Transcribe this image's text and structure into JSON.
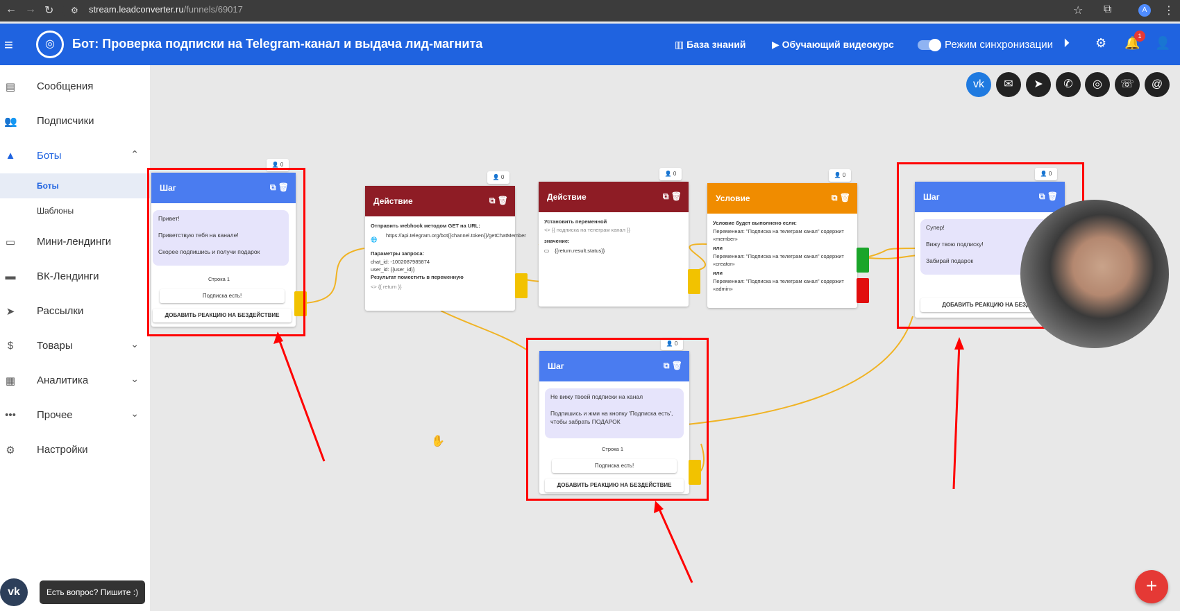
{
  "browser": {
    "url_host": "stream.leadconverter.ru",
    "url_path": "/funnels/69017",
    "profile_letter": "A"
  },
  "header": {
    "title": "Бот: Проверка подписки на Telegram-канал и выдача лид-магнита",
    "knowledge_base": "База знаний",
    "video_course": "Обучающий видеокурс",
    "sync_mode": "Режим синхронизации",
    "notifications_count": "1",
    "accent_color": "#1f63e0"
  },
  "sidebar": {
    "items": [
      {
        "label": "Сообщения",
        "icon": "message-icon"
      },
      {
        "label": "Подписчики",
        "icon": "people-icon"
      },
      {
        "label": "Боты",
        "icon": "robot-icon"
      },
      {
        "label": "Мини-лендинги",
        "icon": "window-icon"
      },
      {
        "label": "ВК-Лендинги",
        "icon": "card-icon"
      },
      {
        "label": "Рассылки",
        "icon": "send-icon"
      },
      {
        "label": "Товары",
        "icon": "dollar-icon"
      },
      {
        "label": "Аналитика",
        "icon": "chart-icon"
      },
      {
        "label": "Прочее",
        "icon": "more-icon"
      },
      {
        "label": "Настройки",
        "icon": "gear-icon"
      }
    ],
    "sub_items": [
      "Боты",
      "Шаблоны"
    ]
  },
  "social": [
    "vk-icon",
    "messenger-icon",
    "telegram-icon",
    "viber-icon",
    "instagram-icon",
    "whatsapp-icon",
    "email-icon"
  ],
  "nodes": {
    "step1": {
      "header": "Шаг",
      "count": "0",
      "text1": "Привет!",
      "text2": "Приветствую тебя на канале!",
      "text3": "Скорее подпишись и получи подарок",
      "row": "Строка 1",
      "button": "Подписка есть!",
      "reaction": "ДОБАВИТЬ РЕАКЦИЮ НА БЕЗДЕЙСТВИЕ"
    },
    "action1": {
      "header": "Действие",
      "count": "0",
      "line1": "Отправить webhook методом GET на URL:",
      "url": "https://api.telegram.org/bot{{channel.token}}/getChatMember",
      "params_title": "Параметры запроса:",
      "param1": "chat_id: -1002087985874",
      "param2": "user_id: {{user_id}}",
      "result_title": "Результат поместить в переменную",
      "result_var": "{{ return }}"
    },
    "action2": {
      "header": "Действие",
      "count": "0",
      "line1": "Установить переменной",
      "var": "{{ подписка на телеграм канал }}",
      "value_title": "значение:",
      "value": "{{return.result.status}}"
    },
    "condition": {
      "header": "Условие",
      "count": "0",
      "line1": "Условие будет выполнено если:",
      "c1": "Переменная: \"Подписка на телеграм канал\" содержит «member»",
      "or1": "или",
      "c2": "Переменная: \"Подписка на телеграм канал\" содержит «creator»",
      "or2": "или",
      "c3": "Переменная: \"Подписка на телеграм канал\" содержит «admin»"
    },
    "step2": {
      "header": "Шаг",
      "count": "0",
      "text1": "Супер!",
      "text2": "Вижу твою подписку!",
      "text3": "Забирай подарок",
      "reaction": "ДОБАВИТЬ РЕАКЦИЮ НА БЕЗДЕЙ"
    },
    "step3": {
      "header": "Шаг",
      "count": "0",
      "text1": "Не вижу твоей подписки на канал",
      "text2": "Подпишись и жми на кнопку 'Подписка есть',",
      "text3": "чтобы забрать ПОДАРОК",
      "row": "Строка 1",
      "button": "Подписка есть!",
      "reaction": "ДОБАВИТЬ РЕАКЦИЮ НА БЕЗДЕЙСТВИЕ"
    }
  },
  "chat": {
    "tooltip": "Есть вопрос? Пишите :)"
  }
}
